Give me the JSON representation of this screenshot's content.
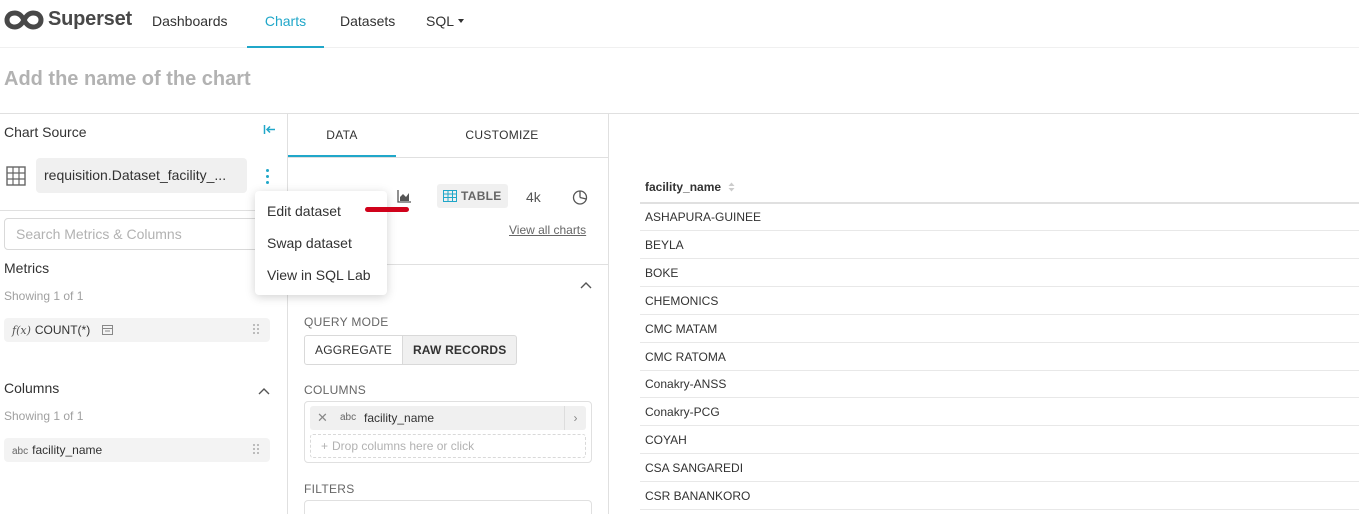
{
  "app": {
    "brand": "Superset",
    "accent_color": "#20a7c9"
  },
  "nav": {
    "items": [
      "Dashboards",
      "Charts",
      "Datasets",
      "SQL"
    ],
    "active": "Charts"
  },
  "chart": {
    "name_placeholder": "Add the name of the chart"
  },
  "left": {
    "source_title": "Chart Source",
    "dataset_name": "requisition.Dataset_facility_...",
    "search_placeholder": "Search Metrics & Columns",
    "metrics_title": "Metrics",
    "metrics_showing": "Showing 1 of 1",
    "metric_prefix": "f(x)",
    "metric_item": "COUNT(*)",
    "columns_title": "Columns",
    "columns_showing": "Showing 1 of 1",
    "column_type": "abc",
    "column_item": "facility_name"
  },
  "dropdown": {
    "items": [
      "Edit dataset",
      "Swap dataset",
      "View in SQL Lab"
    ]
  },
  "middle": {
    "tabs": [
      "DATA",
      "CUSTOMIZE"
    ],
    "viz_table_label": "TABLE",
    "viz_bignumber_label": "4k",
    "view_all_charts": "View all charts",
    "query_mode_label": "QUERY MODE",
    "mode_aggregate": "AGGREGATE",
    "mode_raw": "RAW RECORDS",
    "columns_label": "COLUMNS",
    "column_chip_type": "abc",
    "column_chip_name": "facility_name",
    "drop_placeholder": "Drop columns here or click",
    "filters_label": "FILTERS"
  },
  "results": {
    "column_header": "facility_name",
    "rows": [
      "ASHAPURA-GUINEE",
      "BEYLA",
      "BOKE",
      "CHEMONICS",
      "CMC MATAM",
      "CMC RATOMA",
      "Conakry-ANSS",
      "Conakry-PCG",
      "COYAH",
      "CSA SANGAREDI",
      "CSR BANANKORO"
    ]
  }
}
